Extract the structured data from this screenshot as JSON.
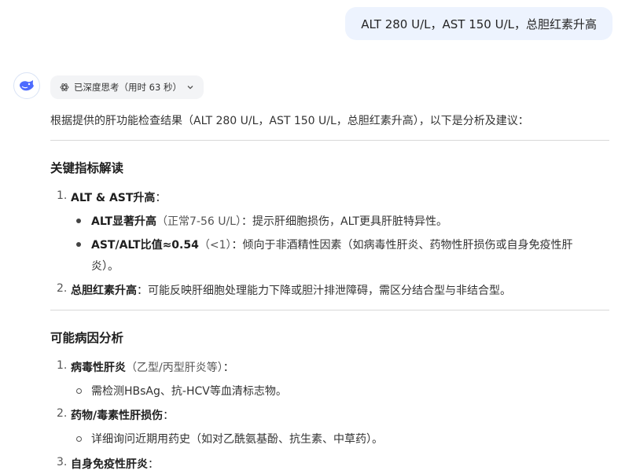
{
  "user_message": "ALT 280 U/L，AST 150 U/L，总胆红素升高",
  "thinking": {
    "label": "已深度思考（用时 63 秒）",
    "icon": "atom-icon",
    "toggle_icon": "chevron-down-icon"
  },
  "intro": "根据提供的肝功能检查结果（ALT 280 U/L，AST 150 U/L，总胆红素升高），以下是分析及建议：",
  "section1": {
    "heading": "关键指标解读",
    "items": [
      {
        "num": "1.",
        "title": "ALT & AST升高",
        "suffix": "：",
        "subs": [
          {
            "bold": "ALT显著升高",
            "muted": "（正常7-56 U/L）",
            "text": "：提示肝细胞损伤，ALT更具肝脏特异性。"
          },
          {
            "bold": "AST/ALT比值≈0.54",
            "muted": "（<1）",
            "text": "：倾向于非酒精性因素（如病毒性肝炎、药物性肝损伤或自身免疫性肝",
            "cont": "炎）。"
          }
        ]
      },
      {
        "num": "2.",
        "title": "总胆红素升高",
        "suffix": "：可能反映肝细胞处理能力下降或胆汁排泄障碍，需区分结合型与非结合型。"
      }
    ]
  },
  "section2": {
    "heading": "可能病因分析",
    "items": [
      {
        "num": "1.",
        "title": "病毒性肝炎",
        "muted": "（乙型/丙型肝炎等）",
        "suffix": "：",
        "sub": "需检测HBsAg、抗-HCV等血清标志物。"
      },
      {
        "num": "2.",
        "title": "药物/毒素性肝损伤",
        "suffix": "：",
        "sub": "详细询问近期用药史（如对乙酰氨基酚、抗生素、中草药）。"
      },
      {
        "num": "3.",
        "title": "自身免疫性肝炎",
        "suffix": "："
      }
    ]
  }
}
